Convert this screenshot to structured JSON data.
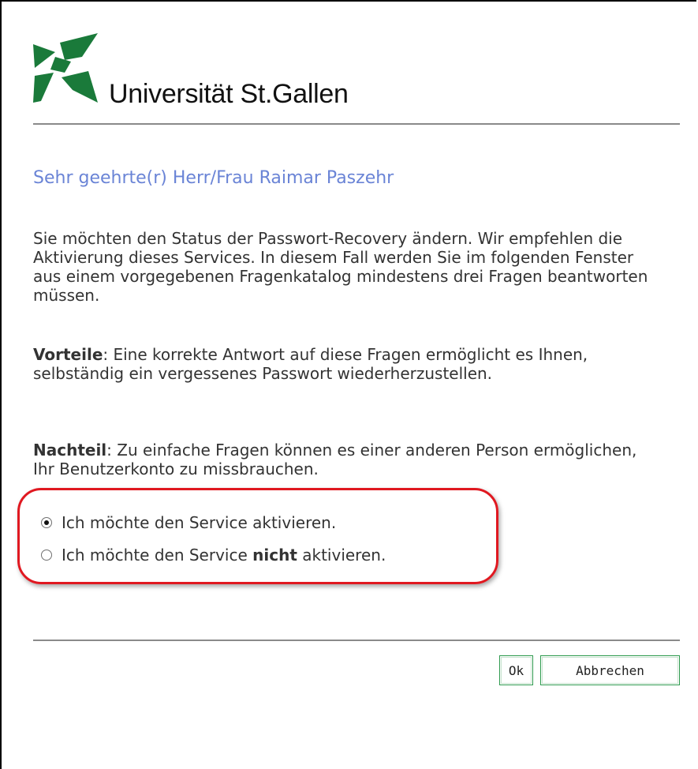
{
  "brand": {
    "name": "Universität St.Gallen",
    "color": "#1a7a3a"
  },
  "greeting": "Sehr geehrte(r) Herr/Frau Raimar Paszehr",
  "intro": "Sie möchten den Status der Passwort-Recovery ändern. Wir empfehlen die Aktivierung dieses Services. In diesem Fall werden Sie im folgenden Fenster aus einem vorgegebenen Fragenkatalog mindestens drei Fragen beantworten müssen.",
  "advantage": {
    "label": "Vorteile",
    "text": ": Eine korrekte Antwort auf diese Fragen ermöglicht es Ihnen, selbständig ein vergessenes Passwort wiederherzustellen."
  },
  "disadvantage": {
    "label": "Nachteil",
    "text": ": Zu einfache Fragen können es einer anderen Person ermöglichen, Ihr Benutzerkonto zu missbrauchen."
  },
  "options": {
    "activate": {
      "label": "Ich möchte den Service aktivieren.",
      "checked": true
    },
    "deactivate": {
      "prefix": "Ich möchte den Service ",
      "emphasis": "nicht",
      "suffix": " aktivieren.",
      "checked": false
    }
  },
  "buttons": {
    "ok": "Ok",
    "cancel": "Abbrechen"
  },
  "colors": {
    "greeting": "#6a84d6",
    "highlight": "#e01820",
    "button_border": "#2e9a4e"
  }
}
